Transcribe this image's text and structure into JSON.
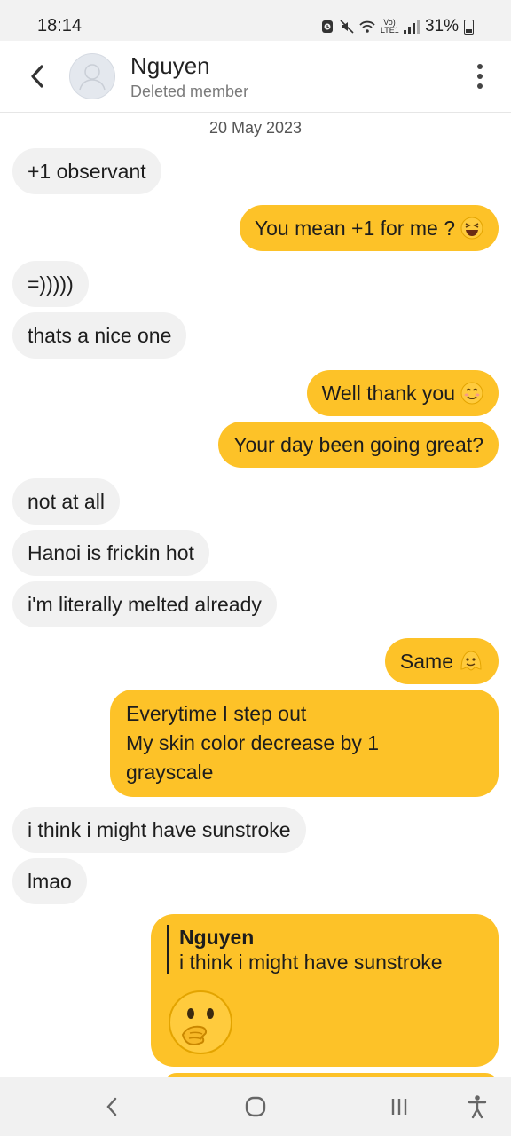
{
  "status_bar": {
    "time": "18:14",
    "network": "Vo) LTE1",
    "battery": "31%"
  },
  "header": {
    "contact_name": "Nguyen",
    "contact_status": "Deleted member"
  },
  "chat": {
    "date": "20 May 2023",
    "messages": [
      {
        "from": "them",
        "text": "+1 observant"
      },
      {
        "from": "me",
        "text": "You mean +1 for me ?",
        "emoji": "laughing-squint-emoji"
      },
      {
        "from": "them",
        "text": "=)))))"
      },
      {
        "from": "them",
        "text": "thats a nice one"
      },
      {
        "from": "me",
        "text": "Well thank you",
        "emoji": "smiling-blush-emoji"
      },
      {
        "from": "me",
        "text": "Your day been going great?"
      },
      {
        "from": "them",
        "text": "not at all"
      },
      {
        "from": "them",
        "text": "Hanoi is frickin hot"
      },
      {
        "from": "them",
        "text": "i'm literally melted already"
      },
      {
        "from": "me",
        "text": "Same",
        "emoji": "melting-face-emoji"
      },
      {
        "from": "me",
        "lines": [
          "Everytime I step out",
          "My skin color decrease by 1",
          "grayscale"
        ]
      },
      {
        "from": "them",
        "text": "i think i might have sunstroke"
      },
      {
        "from": "them",
        "text": "lmao"
      },
      {
        "from": "me",
        "reply_to": {
          "name": "Nguyen",
          "text": "i think i might have sunstroke"
        },
        "emoji": "face-with-hand-over-mouth-emoji"
      }
    ]
  },
  "colors": {
    "outgoing_bubble": "#fdc228",
    "incoming_bubble": "#f1f1f1"
  }
}
